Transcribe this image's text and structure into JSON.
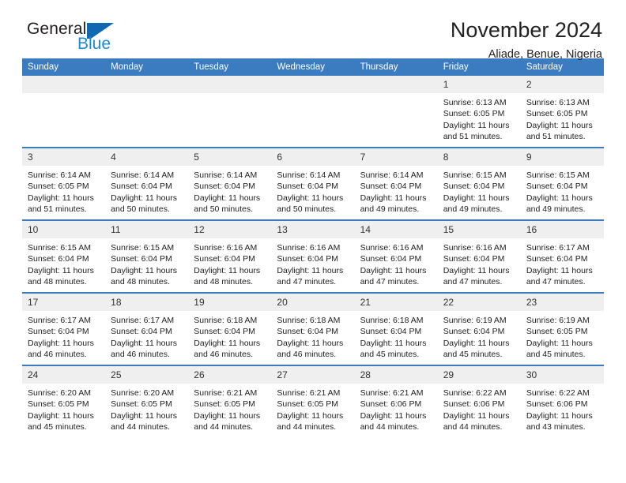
{
  "brand": {
    "name_part1": "General",
    "name_part2": "Blue",
    "logo_icon": "triangle-flag-icon",
    "color_dark": "#231f20",
    "color_blue": "#1c8bd6",
    "color_mark": "#1068b3"
  },
  "header": {
    "title": "November 2024",
    "subtitle": "Aliade, Benue, Nigeria"
  },
  "theme": {
    "header_bg": "#3b7cc0",
    "daynum_bg": "#efefef",
    "cell_bg": "#ffffff",
    "text": "#222222"
  },
  "weekdays": [
    "Sunday",
    "Monday",
    "Tuesday",
    "Wednesday",
    "Thursday",
    "Friday",
    "Saturday"
  ],
  "labels": {
    "sunrise_prefix": "Sunrise:",
    "sunset_prefix": "Sunset:",
    "daylight_prefix": "Daylight:"
  },
  "weeks": [
    [
      {
        "day": "",
        "blank": true,
        "sunrise": "",
        "sunset": "",
        "daylight": ""
      },
      {
        "day": "",
        "blank": true,
        "sunrise": "",
        "sunset": "",
        "daylight": ""
      },
      {
        "day": "",
        "blank": true,
        "sunrise": "",
        "sunset": "",
        "daylight": ""
      },
      {
        "day": "",
        "blank": true,
        "sunrise": "",
        "sunset": "",
        "daylight": ""
      },
      {
        "day": "",
        "blank": true,
        "sunrise": "",
        "sunset": "",
        "daylight": ""
      },
      {
        "day": "1",
        "blank": false,
        "sunrise": "Sunrise: 6:13 AM",
        "sunset": "Sunset: 6:05 PM",
        "daylight": "Daylight: 11 hours and 51 minutes."
      },
      {
        "day": "2",
        "blank": false,
        "sunrise": "Sunrise: 6:13 AM",
        "sunset": "Sunset: 6:05 PM",
        "daylight": "Daylight: 11 hours and 51 minutes."
      }
    ],
    [
      {
        "day": "3",
        "blank": false,
        "sunrise": "Sunrise: 6:14 AM",
        "sunset": "Sunset: 6:05 PM",
        "daylight": "Daylight: 11 hours and 51 minutes."
      },
      {
        "day": "4",
        "blank": false,
        "sunrise": "Sunrise: 6:14 AM",
        "sunset": "Sunset: 6:04 PM",
        "daylight": "Daylight: 11 hours and 50 minutes."
      },
      {
        "day": "5",
        "blank": false,
        "sunrise": "Sunrise: 6:14 AM",
        "sunset": "Sunset: 6:04 PM",
        "daylight": "Daylight: 11 hours and 50 minutes."
      },
      {
        "day": "6",
        "blank": false,
        "sunrise": "Sunrise: 6:14 AM",
        "sunset": "Sunset: 6:04 PM",
        "daylight": "Daylight: 11 hours and 50 minutes."
      },
      {
        "day": "7",
        "blank": false,
        "sunrise": "Sunrise: 6:14 AM",
        "sunset": "Sunset: 6:04 PM",
        "daylight": "Daylight: 11 hours and 49 minutes."
      },
      {
        "day": "8",
        "blank": false,
        "sunrise": "Sunrise: 6:15 AM",
        "sunset": "Sunset: 6:04 PM",
        "daylight": "Daylight: 11 hours and 49 minutes."
      },
      {
        "day": "9",
        "blank": false,
        "sunrise": "Sunrise: 6:15 AM",
        "sunset": "Sunset: 6:04 PM",
        "daylight": "Daylight: 11 hours and 49 minutes."
      }
    ],
    [
      {
        "day": "10",
        "blank": false,
        "sunrise": "Sunrise: 6:15 AM",
        "sunset": "Sunset: 6:04 PM",
        "daylight": "Daylight: 11 hours and 48 minutes."
      },
      {
        "day": "11",
        "blank": false,
        "sunrise": "Sunrise: 6:15 AM",
        "sunset": "Sunset: 6:04 PM",
        "daylight": "Daylight: 11 hours and 48 minutes."
      },
      {
        "day": "12",
        "blank": false,
        "sunrise": "Sunrise: 6:16 AM",
        "sunset": "Sunset: 6:04 PM",
        "daylight": "Daylight: 11 hours and 48 minutes."
      },
      {
        "day": "13",
        "blank": false,
        "sunrise": "Sunrise: 6:16 AM",
        "sunset": "Sunset: 6:04 PM",
        "daylight": "Daylight: 11 hours and 47 minutes."
      },
      {
        "day": "14",
        "blank": false,
        "sunrise": "Sunrise: 6:16 AM",
        "sunset": "Sunset: 6:04 PM",
        "daylight": "Daylight: 11 hours and 47 minutes."
      },
      {
        "day": "15",
        "blank": false,
        "sunrise": "Sunrise: 6:16 AM",
        "sunset": "Sunset: 6:04 PM",
        "daylight": "Daylight: 11 hours and 47 minutes."
      },
      {
        "day": "16",
        "blank": false,
        "sunrise": "Sunrise: 6:17 AM",
        "sunset": "Sunset: 6:04 PM",
        "daylight": "Daylight: 11 hours and 47 minutes."
      }
    ],
    [
      {
        "day": "17",
        "blank": false,
        "sunrise": "Sunrise: 6:17 AM",
        "sunset": "Sunset: 6:04 PM",
        "daylight": "Daylight: 11 hours and 46 minutes."
      },
      {
        "day": "18",
        "blank": false,
        "sunrise": "Sunrise: 6:17 AM",
        "sunset": "Sunset: 6:04 PM",
        "daylight": "Daylight: 11 hours and 46 minutes."
      },
      {
        "day": "19",
        "blank": false,
        "sunrise": "Sunrise: 6:18 AM",
        "sunset": "Sunset: 6:04 PM",
        "daylight": "Daylight: 11 hours and 46 minutes."
      },
      {
        "day": "20",
        "blank": false,
        "sunrise": "Sunrise: 6:18 AM",
        "sunset": "Sunset: 6:04 PM",
        "daylight": "Daylight: 11 hours and 46 minutes."
      },
      {
        "day": "21",
        "blank": false,
        "sunrise": "Sunrise: 6:18 AM",
        "sunset": "Sunset: 6:04 PM",
        "daylight": "Daylight: 11 hours and 45 minutes."
      },
      {
        "day": "22",
        "blank": false,
        "sunrise": "Sunrise: 6:19 AM",
        "sunset": "Sunset: 6:04 PM",
        "daylight": "Daylight: 11 hours and 45 minutes."
      },
      {
        "day": "23",
        "blank": false,
        "sunrise": "Sunrise: 6:19 AM",
        "sunset": "Sunset: 6:05 PM",
        "daylight": "Daylight: 11 hours and 45 minutes."
      }
    ],
    [
      {
        "day": "24",
        "blank": false,
        "sunrise": "Sunrise: 6:20 AM",
        "sunset": "Sunset: 6:05 PM",
        "daylight": "Daylight: 11 hours and 45 minutes."
      },
      {
        "day": "25",
        "blank": false,
        "sunrise": "Sunrise: 6:20 AM",
        "sunset": "Sunset: 6:05 PM",
        "daylight": "Daylight: 11 hours and 44 minutes."
      },
      {
        "day": "26",
        "blank": false,
        "sunrise": "Sunrise: 6:21 AM",
        "sunset": "Sunset: 6:05 PM",
        "daylight": "Daylight: 11 hours and 44 minutes."
      },
      {
        "day": "27",
        "blank": false,
        "sunrise": "Sunrise: 6:21 AM",
        "sunset": "Sunset: 6:05 PM",
        "daylight": "Daylight: 11 hours and 44 minutes."
      },
      {
        "day": "28",
        "blank": false,
        "sunrise": "Sunrise: 6:21 AM",
        "sunset": "Sunset: 6:06 PM",
        "daylight": "Daylight: 11 hours and 44 minutes."
      },
      {
        "day": "29",
        "blank": false,
        "sunrise": "Sunrise: 6:22 AM",
        "sunset": "Sunset: 6:06 PM",
        "daylight": "Daylight: 11 hours and 44 minutes."
      },
      {
        "day": "30",
        "blank": false,
        "sunrise": "Sunrise: 6:22 AM",
        "sunset": "Sunset: 6:06 PM",
        "daylight": "Daylight: 11 hours and 43 minutes."
      }
    ]
  ]
}
